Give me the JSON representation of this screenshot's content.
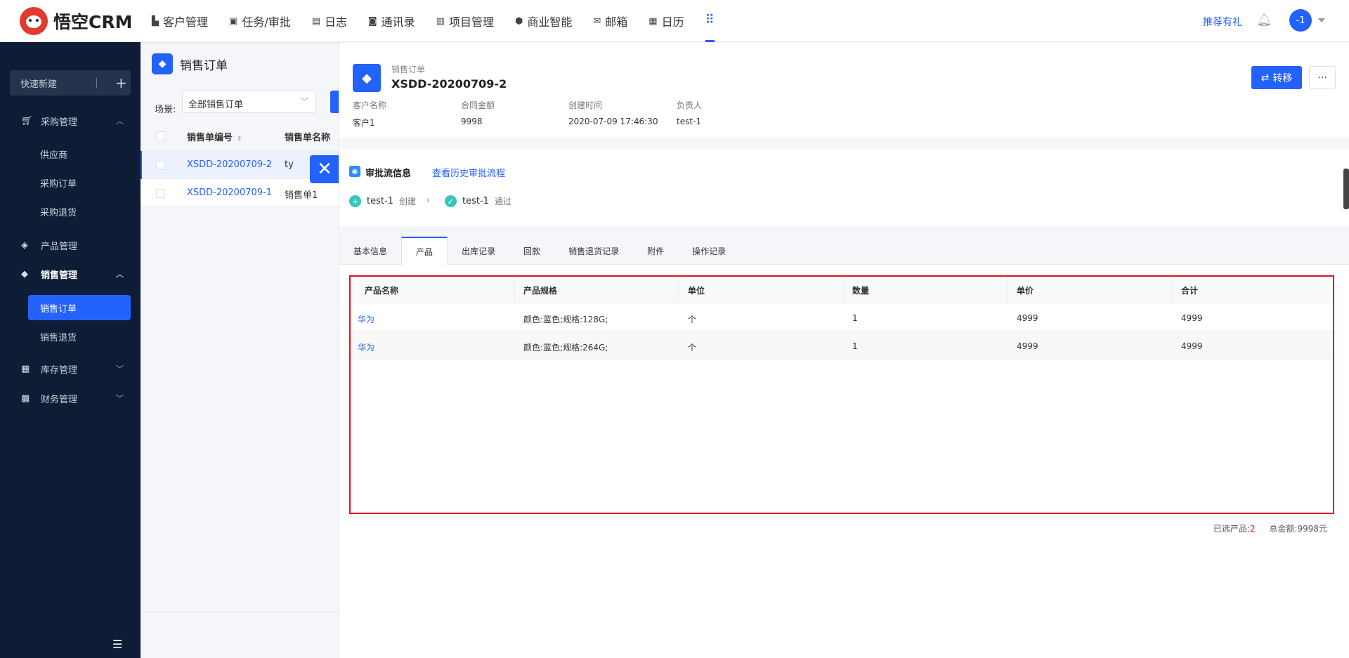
{
  "app": {
    "brand": "悟空CRM"
  },
  "topnav": {
    "items": [
      {
        "label": "客户管理",
        "icon": "customer-icon"
      },
      {
        "label": "任务/审批",
        "icon": "briefcase-icon"
      },
      {
        "label": "日志",
        "icon": "log-icon"
      },
      {
        "label": "通讯录",
        "icon": "contacts-icon"
      },
      {
        "label": "项目管理",
        "icon": "project-icon"
      },
      {
        "label": "商业智能",
        "icon": "bi-icon"
      },
      {
        "label": "邮箱",
        "icon": "mail-icon"
      },
      {
        "label": "日历",
        "icon": "calendar-icon"
      }
    ],
    "gift": "推荐有礼",
    "avatar": "-1"
  },
  "sidebar": {
    "quick": "快速新建",
    "menus": [
      {
        "label": "采购管理",
        "icon": "cart-icon",
        "expanded": true,
        "subs": [
          "供应商",
          "采购订单",
          "采购退货"
        ]
      },
      {
        "label": "产品管理",
        "icon": "box-icon"
      },
      {
        "label": "销售管理",
        "icon": "tag-icon",
        "expanded": true,
        "subs": [
          "销售订单",
          "销售退货"
        ],
        "active_sub": "销售订单"
      },
      {
        "label": "库存管理",
        "icon": "warehouse-icon"
      },
      {
        "label": "财务管理",
        "icon": "wallet-icon"
      }
    ]
  },
  "list": {
    "title": "销售订单",
    "scene_label": "场景:",
    "scene_value": "全部销售订单",
    "columns": [
      "销售单编号",
      "销售单名称"
    ],
    "rows": [
      {
        "no": "XSDD-20200709-2",
        "name": "ty"
      },
      {
        "no": "XSDD-20200709-1",
        "name": "销售单1"
      }
    ]
  },
  "detail": {
    "type": "销售订单",
    "number": "XSDD-20200709-2",
    "fields": [
      {
        "label": "客户名称",
        "value": "客户1"
      },
      {
        "label": "合同金额",
        "value": "9998"
      },
      {
        "label": "创建时间",
        "value": "2020-07-09 17:46:30"
      },
      {
        "label": "负责人",
        "value": "test-1"
      }
    ],
    "transfer": "转移",
    "more": "···",
    "approval": {
      "title": "审批流信息",
      "history": "查看历史审批流程",
      "steps": [
        {
          "user": "test-1",
          "action": "创建"
        },
        {
          "user": "test-1",
          "action": "通过"
        }
      ]
    },
    "tabs": [
      "基本信息",
      "产品",
      "出库记录",
      "回款",
      "销售退货记录",
      "附件",
      "操作记录"
    ],
    "active_tab": "产品",
    "products": {
      "columns": [
        "产品名称",
        "产品规格",
        "单位",
        "数量",
        "单价",
        "合计"
      ],
      "rows": [
        [
          "华为",
          "颜色:蓝色;规格:128G;",
          "个",
          "1",
          "4999",
          "4999"
        ],
        [
          "华为",
          "颜色:蓝色;规格:264G;",
          "个",
          "1",
          "4999",
          "4999"
        ]
      ],
      "selected_label": "已选产品:",
      "selected_count": "2",
      "total_label": "总金额:",
      "total_value": "9998元"
    }
  },
  "colors": {
    "accent": "#2362fb",
    "sidebar": "#0d1d36",
    "highlight": "#e1101d"
  }
}
